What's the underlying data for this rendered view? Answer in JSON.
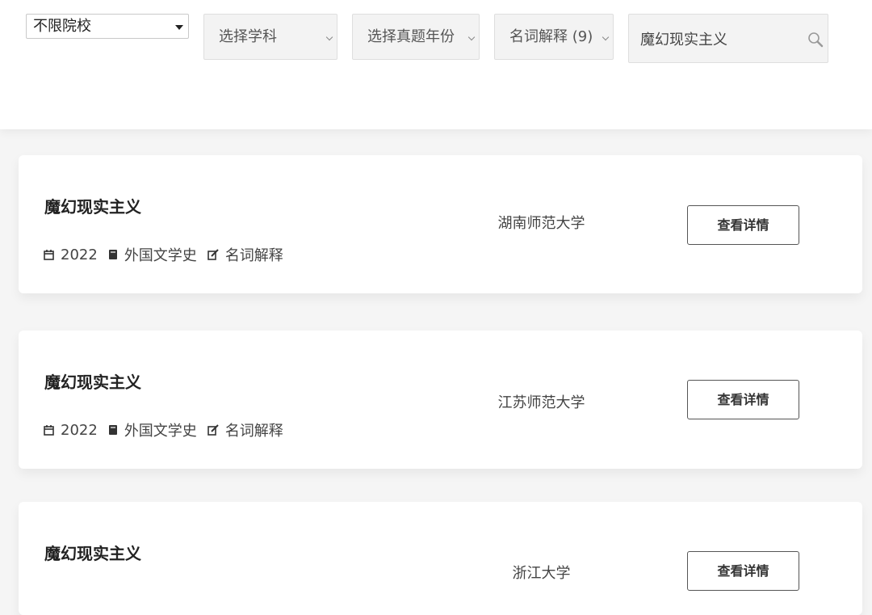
{
  "filters": {
    "school": "不限院校",
    "subject": "选择学科",
    "year": "选择真题年份",
    "type": "名词解释 (9)",
    "search_value": "魔幻现实主义"
  },
  "icons": {
    "search": "search-icon",
    "calendar": "calendar-icon",
    "book": "book-icon",
    "edit": "edit-icon"
  },
  "results": [
    {
      "title": "魔幻现实主义",
      "year": "2022",
      "subject": "外国文学史",
      "type": "名词解释",
      "school": "湖南师范大学",
      "button": "查看详情"
    },
    {
      "title": "魔幻现实主义",
      "year": "2022",
      "subject": "外国文学史",
      "type": "名词解释",
      "school": "江苏师范大学",
      "button": "查看详情"
    },
    {
      "title": "魔幻现实主义",
      "school": "浙江大学",
      "button": "查看详情"
    }
  ]
}
